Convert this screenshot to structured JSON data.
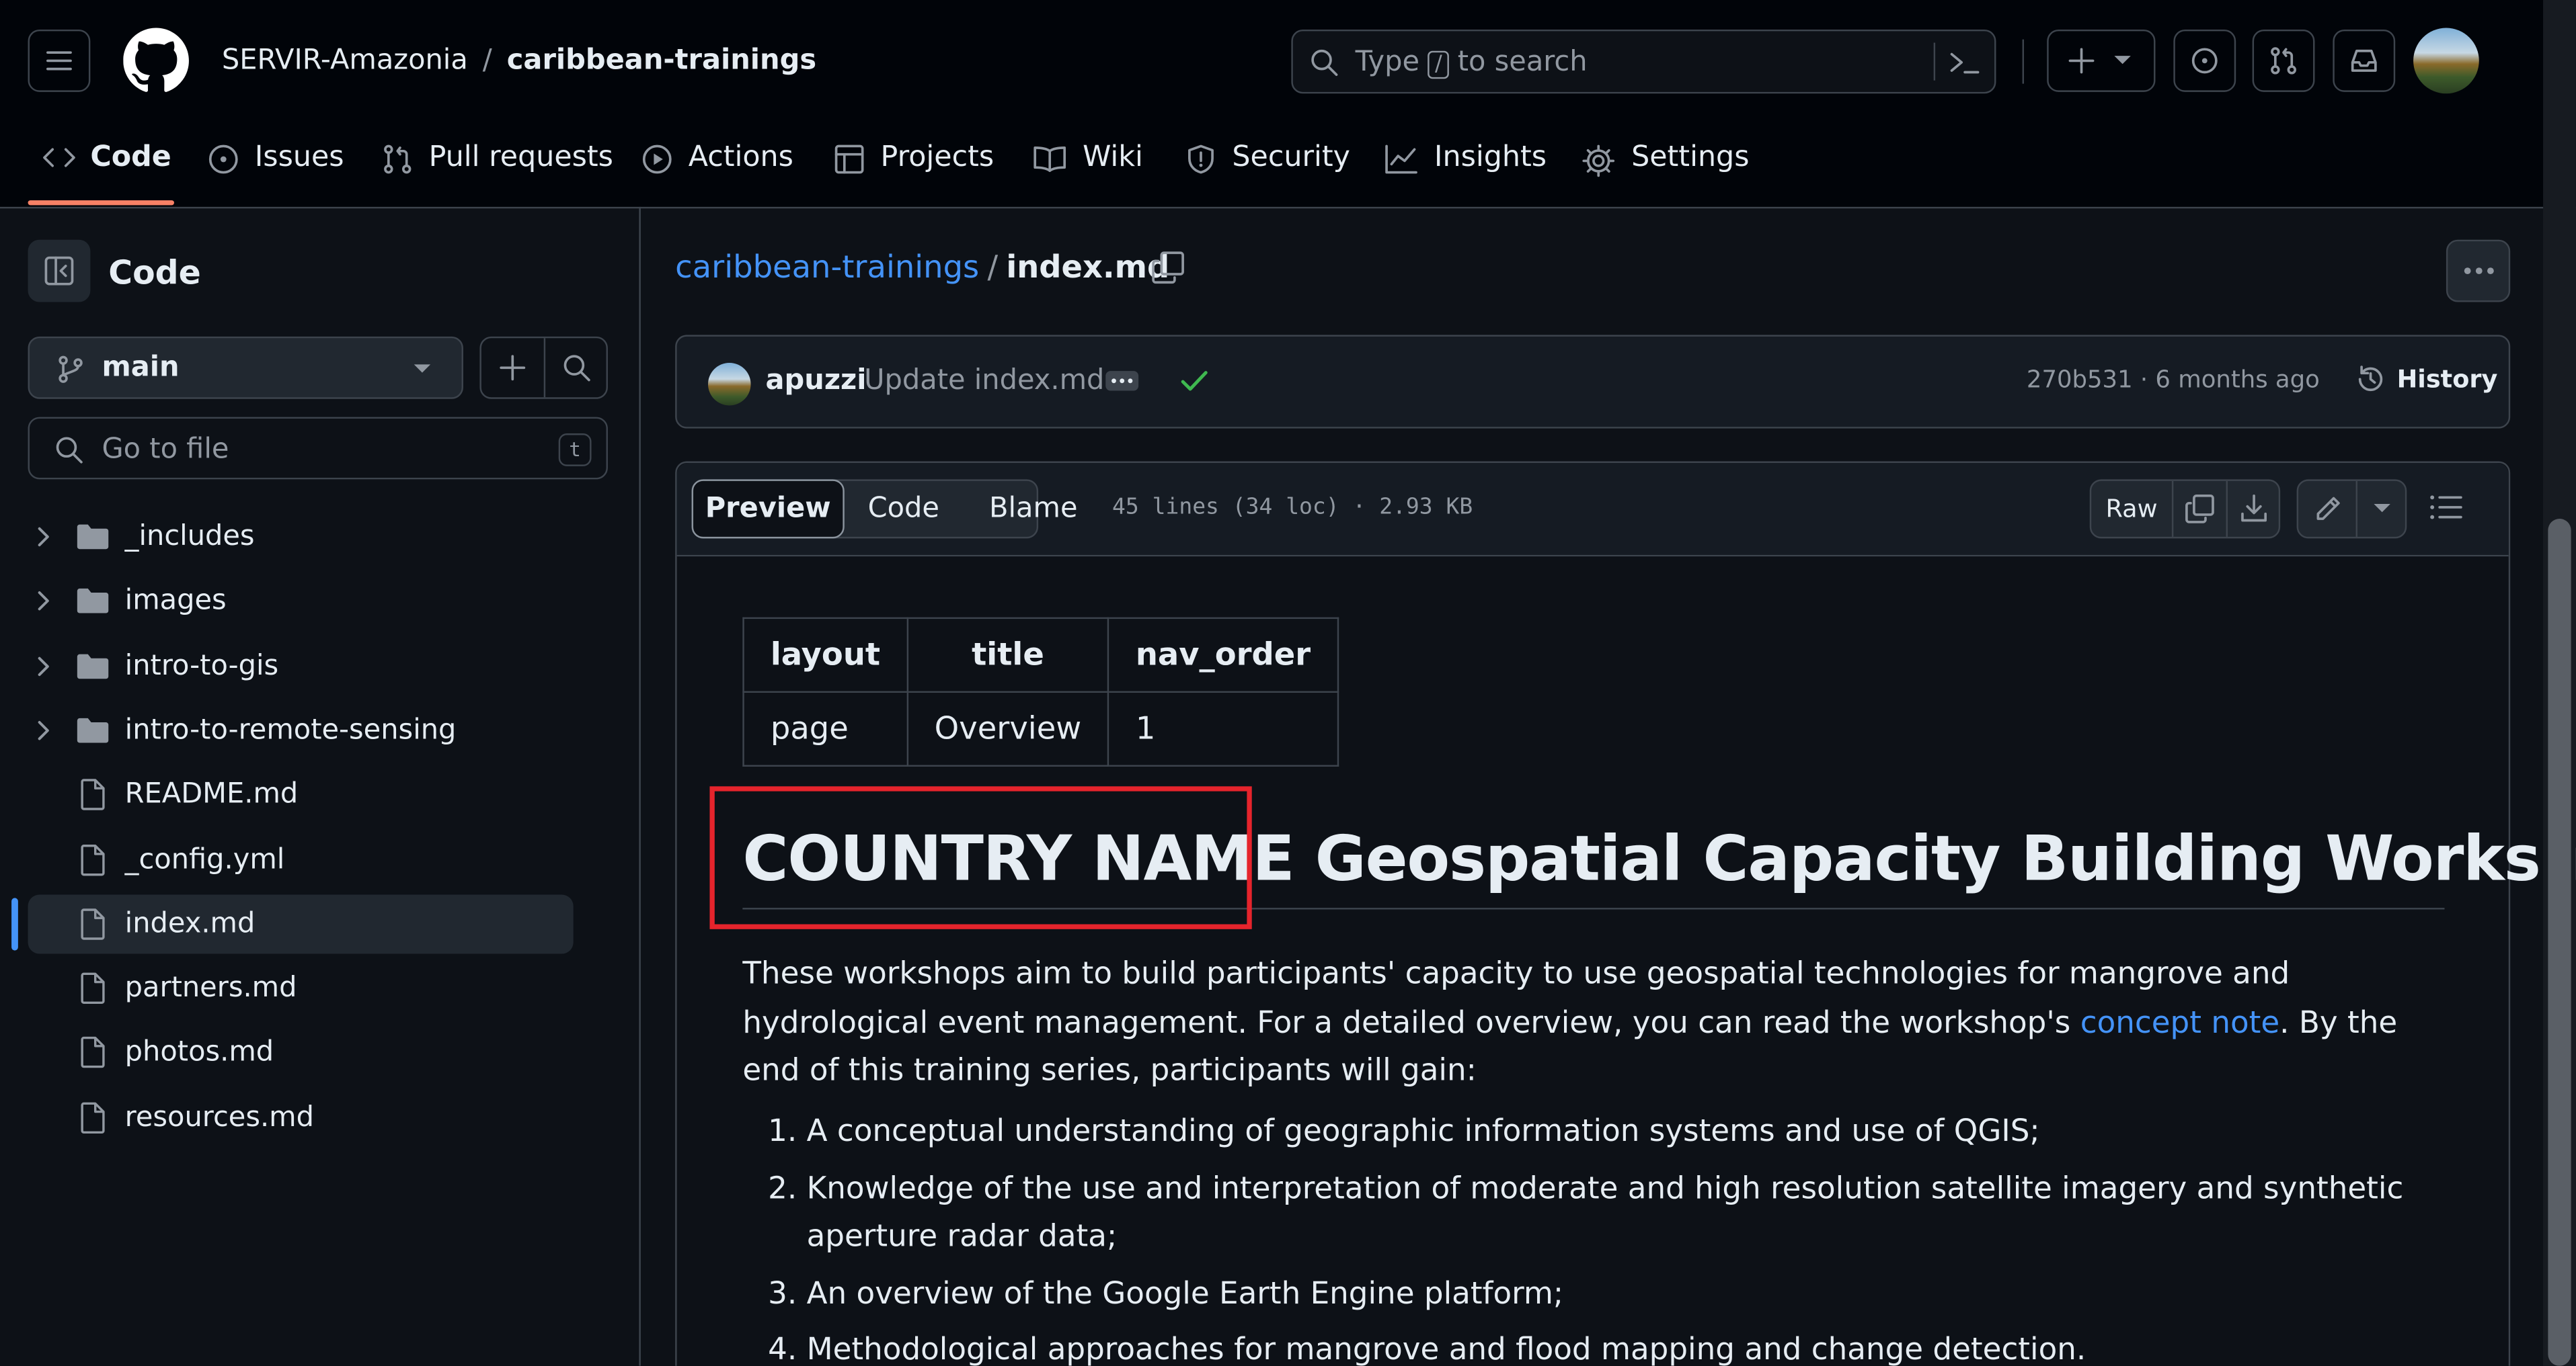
{
  "header": {
    "owner": "SERVIR-Amazonia",
    "separator": "/",
    "repo": "caribbean-trainings",
    "search_prefix": "Type",
    "search_key": "/",
    "search_suffix": "to search"
  },
  "nav": {
    "tabs": [
      {
        "label": "Code",
        "icon": "code-icon",
        "active": true
      },
      {
        "label": "Issues",
        "icon": "issue-icon"
      },
      {
        "label": "Pull requests",
        "icon": "pull-request-icon"
      },
      {
        "label": "Actions",
        "icon": "play-icon"
      },
      {
        "label": "Projects",
        "icon": "table-icon"
      },
      {
        "label": "Wiki",
        "icon": "book-icon"
      },
      {
        "label": "Security",
        "icon": "shield-icon"
      },
      {
        "label": "Insights",
        "icon": "graph-icon"
      },
      {
        "label": "Settings",
        "icon": "gear-icon"
      }
    ]
  },
  "sidebar": {
    "title": "Code",
    "branch": "main",
    "goto_placeholder": "Go to file",
    "goto_shortcut": "t",
    "items": [
      {
        "name": "_includes",
        "type": "folder"
      },
      {
        "name": "images",
        "type": "folder"
      },
      {
        "name": "intro-to-gis",
        "type": "folder"
      },
      {
        "name": "intro-to-remote-sensing",
        "type": "folder"
      },
      {
        "name": "README.md",
        "type": "file"
      },
      {
        "name": "_config.yml",
        "type": "file"
      },
      {
        "name": "index.md",
        "type": "file",
        "active": true
      },
      {
        "name": "partners.md",
        "type": "file"
      },
      {
        "name": "photos.md",
        "type": "file"
      },
      {
        "name": "resources.md",
        "type": "file"
      }
    ]
  },
  "file_header": {
    "repo_link": "caribbean-trainings",
    "separator": "/",
    "filename": "index.md"
  },
  "commit": {
    "author": "apuzzi",
    "message": "Update index.md",
    "meta": "270b531 · 6 months ago",
    "history_label": "History"
  },
  "file_toolbar": {
    "tabs": [
      "Preview",
      "Code",
      "Blame"
    ],
    "stats": "45 lines (34 loc) · 2.93 KB",
    "raw_label": "Raw"
  },
  "content": {
    "table": {
      "headers": [
        "layout",
        "title",
        "nav_order"
      ],
      "row": [
        "page",
        "Overview",
        "1"
      ]
    },
    "heading_highlight": "COUNTRY NAME",
    "heading_rest": "Geospatial Capacity Building Workshops",
    "intro_before_link": "These workshops aim to build participants' capacity to use geospatial technologies for mangrove and hydrological event management. For a detailed overview, you can read the workshop's ",
    "intro_link": "concept note",
    "intro_after_link": ". By the end of this training series, participants will gain:",
    "goals": [
      "A conceptual understanding of geographic information systems and use of QGIS;",
      "Knowledge of the use and interpretation of moderate and high resolution satellite imagery and synthetic aperture radar data;",
      "An overview of the Google Earth Engine platform;",
      "Methodological approaches for mangrove and flood mapping and change detection."
    ]
  },
  "colors": {
    "background": "#0d1117",
    "header": "#010409",
    "link": "#4493f8",
    "active_tab_underline": "#f78166",
    "highlight_box": "#e5242c",
    "success_check": "#3fb950"
  }
}
